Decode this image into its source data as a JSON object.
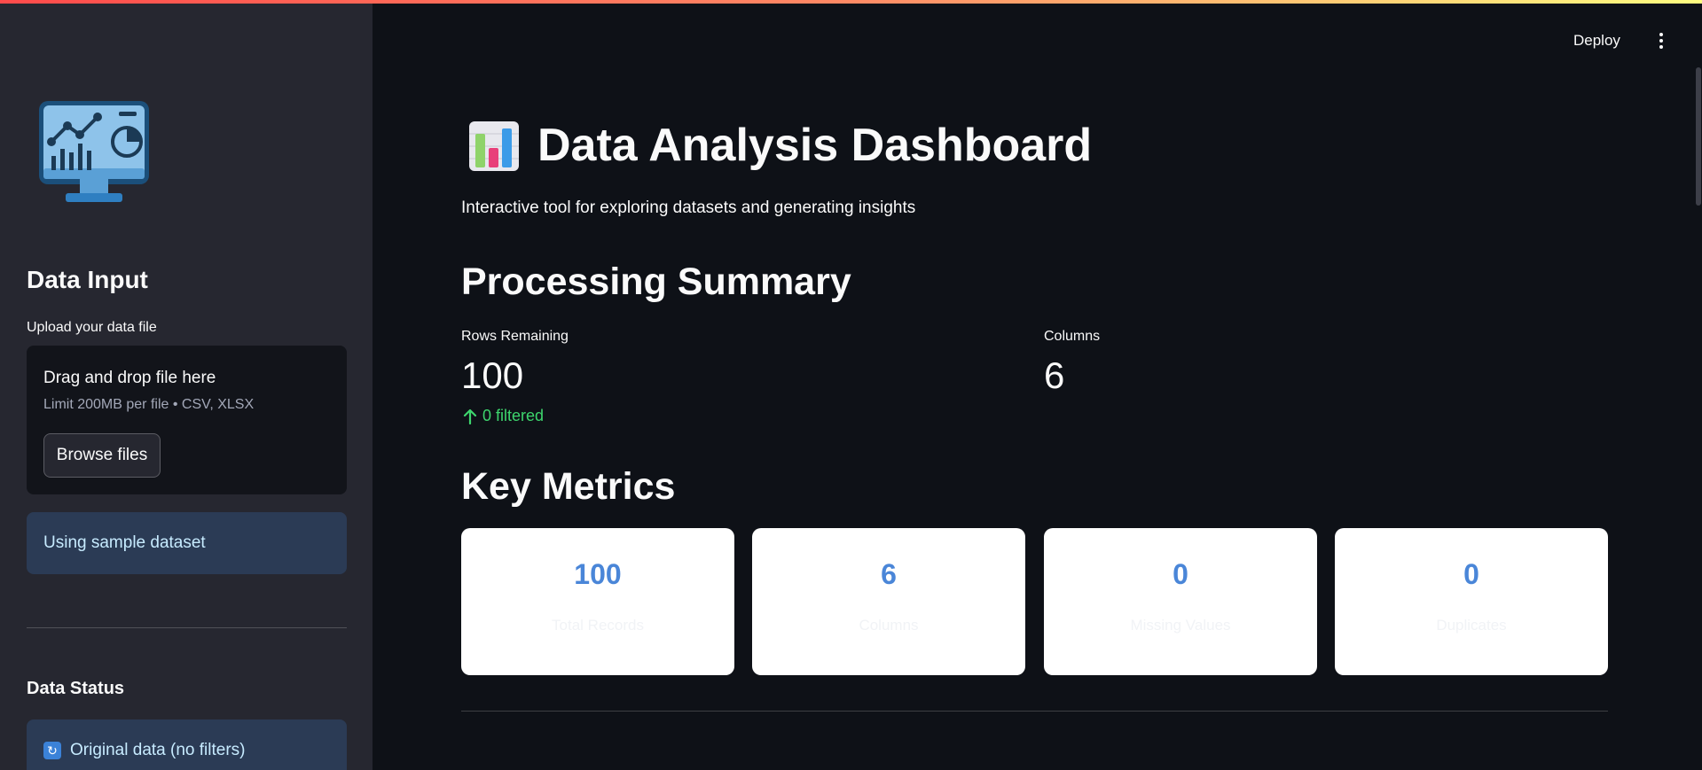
{
  "sidebar": {
    "logo_icon": "analytics-monitor-icon",
    "heading": "Data Input",
    "upload_label": "Upload your data file",
    "dropzone": {
      "title": "Drag and drop file here",
      "limit": "Limit 200MB per file • CSV, XLSX",
      "browse_label": "Browse files"
    },
    "sample_info": "Using sample dataset",
    "status_heading": "Data Status",
    "status_info": "Original data (no filters)",
    "status_icon": "refresh-icon"
  },
  "header": {
    "deploy_label": "Deploy",
    "menu_icon": "more-vertical-icon"
  },
  "main": {
    "title_icon": "bar-chart-icon",
    "title": "Data Analysis Dashboard",
    "subtitle": "Interactive tool for exploring datasets and generating insights",
    "summary": {
      "heading": "Processing Summary",
      "rows_label": "Rows Remaining",
      "rows_value": "100",
      "rows_delta": "0 filtered",
      "columns_label": "Columns",
      "columns_value": "6"
    },
    "metrics": {
      "heading": "Key Metrics",
      "cards": [
        {
          "value": "100",
          "label": "Total Records"
        },
        {
          "value": "6",
          "label": "Columns"
        },
        {
          "value": "0",
          "label": "Missing Values"
        },
        {
          "value": "0",
          "label": "Duplicates"
        }
      ]
    }
  },
  "colors": {
    "background": "#0e1117",
    "sidebar": "#262730",
    "info_box": "#2b3b55",
    "info_text": "#c7ebff",
    "delta_positive": "#3dd56d",
    "metric_value": "#4a86d8"
  }
}
